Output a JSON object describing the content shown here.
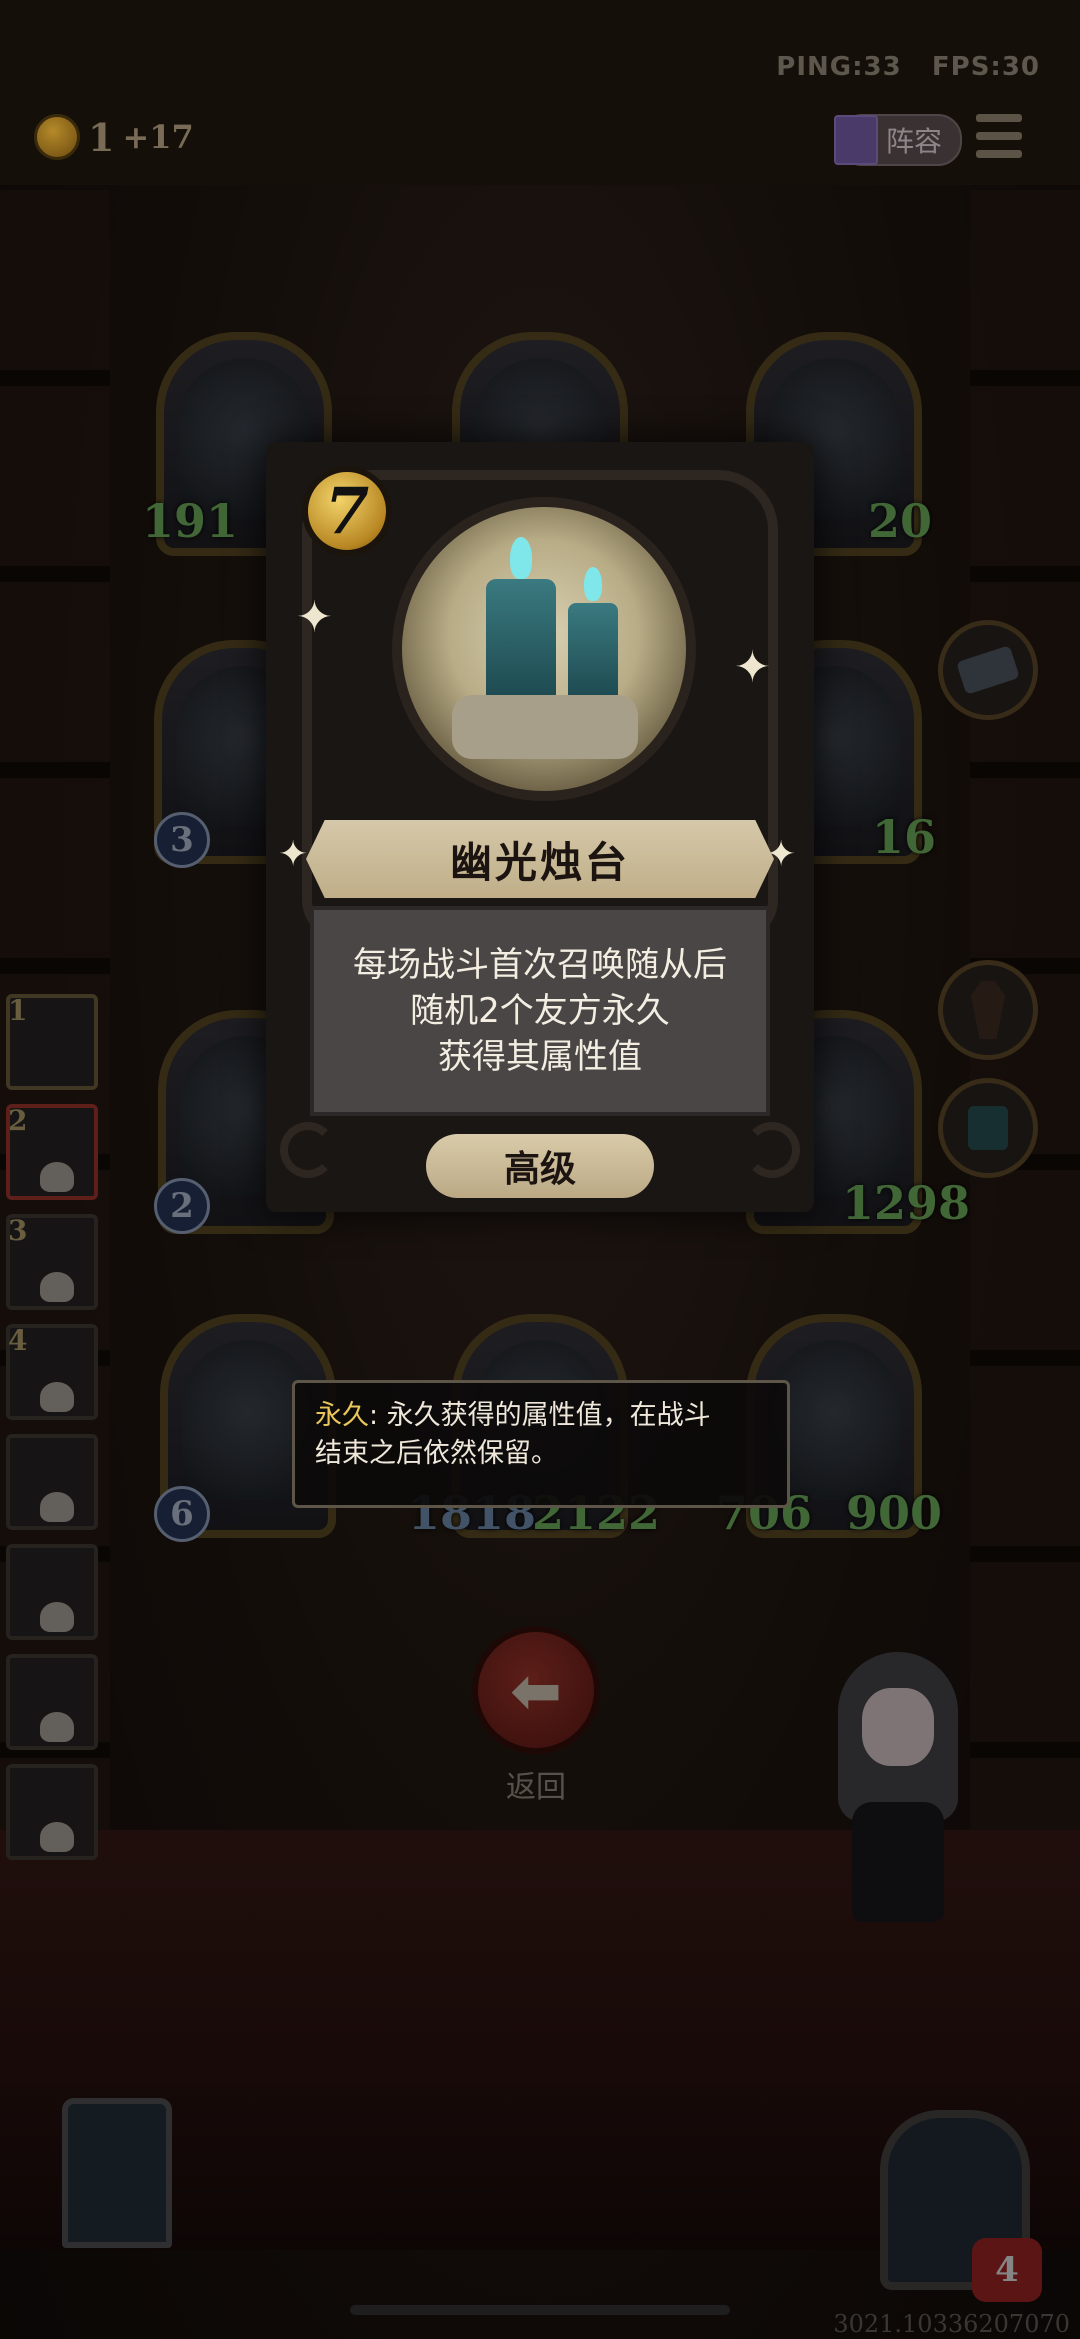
{
  "topbar": {
    "ping": "PING:33",
    "fps": "FPS:30",
    "coins": "1",
    "coins_bonus": "+17",
    "lineup_label": "阵容"
  },
  "board": {
    "row1": [
      {
        "atk": "191",
        "hp": ""
      },
      {
        "atk": "",
        "hp": ""
      },
      {
        "atk": "",
        "hp": "20"
      }
    ],
    "row2": [
      {
        "atk": "3",
        "hp": ""
      },
      {
        "atk": "",
        "hp": "16"
      }
    ],
    "row3": [
      {
        "atk": "2",
        "hp": ""
      },
      {
        "atk": "",
        "hp": "1298"
      }
    ],
    "row4": [
      {
        "atk": "6",
        "hp": ""
      },
      {
        "atk": "1818",
        "hp": "2122"
      },
      {
        "atk": "706",
        "hp": "900"
      }
    ]
  },
  "history": [
    {
      "num": "1"
    },
    {
      "num": "2"
    },
    {
      "num": "3"
    },
    {
      "num": "4"
    },
    {
      "num": ""
    },
    {
      "num": ""
    },
    {
      "num": ""
    },
    {
      "num": ""
    }
  ],
  "card": {
    "cost": "7",
    "name": "幽光烛台",
    "desc": [
      "每场战斗首次召唤随从后",
      "随机2个友方永久",
      "获得其属性值"
    ],
    "tier": "高级"
  },
  "tooltip": {
    "keyword": "永久",
    "line1_rest": ": 永久获得的属性值，在战斗",
    "line2": "结束之后依然保留。"
  },
  "back": {
    "label": "返回",
    "arrow": "⬅"
  },
  "bottom": {
    "lives": "4",
    "build_id": "3021.10336207070"
  }
}
